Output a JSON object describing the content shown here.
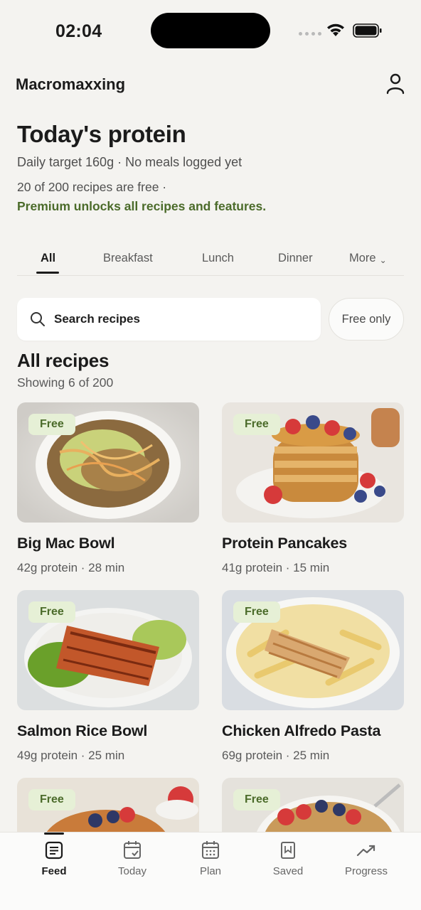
{
  "status": {
    "time": "02:04"
  },
  "header": {
    "app_title": "Macromaxxing"
  },
  "hero": {
    "title": "Today's protein",
    "subtitle": "Daily target 160g · No meals logged yet",
    "free_note": "20 of 200 recipes are free ·",
    "premium_note": "Premium unlocks all recipes and features."
  },
  "tabs": [
    {
      "label": "All",
      "active": true
    },
    {
      "label": "Breakfast"
    },
    {
      "label": "Lunch"
    },
    {
      "label": "Dinner"
    },
    {
      "label": "More"
    }
  ],
  "search": {
    "placeholder": "Search recipes",
    "filter_label": "Free only"
  },
  "section": {
    "title": "All recipes",
    "count": "Showing 6 of 200"
  },
  "recipes": [
    {
      "name": "Big Mac Bowl",
      "meta": "42g protein · 28 min",
      "badge": "Free"
    },
    {
      "name": "Protein Pancakes",
      "meta": "41g protein · 15 min",
      "badge": "Free"
    },
    {
      "name": "Salmon Rice Bowl",
      "meta": "49g protein · 25 min",
      "badge": "Free"
    },
    {
      "name": "Chicken Alfredo Pasta",
      "meta": "69g protein · 25 min",
      "badge": "Free"
    },
    {
      "name": "",
      "meta": "",
      "badge": "Free"
    },
    {
      "name": "",
      "meta": "",
      "badge": "Free"
    }
  ],
  "nav": [
    {
      "label": "Feed",
      "icon": "feed-icon",
      "active": true
    },
    {
      "label": "Today",
      "icon": "calendar-check-icon"
    },
    {
      "label": "Plan",
      "icon": "calendar-grid-icon"
    },
    {
      "label": "Saved",
      "icon": "bookmark-icon"
    },
    {
      "label": "Progress",
      "icon": "trend-up-icon"
    }
  ],
  "colors": {
    "accent_green": "#4b6b2a",
    "badge_bg": "#e6f0d6",
    "background": "#f4f3f0"
  }
}
